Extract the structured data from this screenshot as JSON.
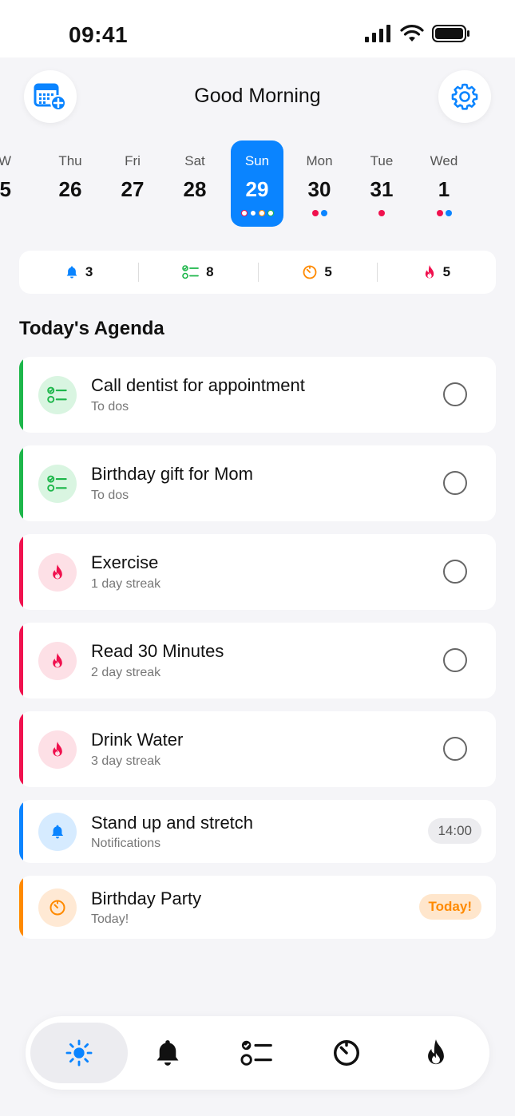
{
  "status_bar": {
    "time": "09:41"
  },
  "header": {
    "title": "Good Morning"
  },
  "week": [
    {
      "name": "Thu",
      "num": "26",
      "dots": []
    },
    {
      "name": "Fri",
      "num": "27",
      "dots": []
    },
    {
      "name": "Sat",
      "num": "28",
      "dots": []
    },
    {
      "name": "Sun",
      "num": "29",
      "dots": [
        "#f0114e",
        "#0a84ff",
        "#ff8a00",
        "#1db64a"
      ],
      "selected": true
    },
    {
      "name": "Mon",
      "num": "30",
      "dots": [
        "#f0114e",
        "#0a84ff"
      ]
    },
    {
      "name": "Tue",
      "num": "31",
      "dots": [
        "#f0114e"
      ]
    },
    {
      "name": "Wed",
      "num": "1",
      "dots": [
        "#f0114e",
        "#0a84ff"
      ]
    }
  ],
  "stats": [
    {
      "icon": "bell-icon",
      "count": "3"
    },
    {
      "icon": "checklist-icon",
      "count": "8"
    },
    {
      "icon": "timer-icon",
      "count": "5"
    },
    {
      "icon": "flame-icon",
      "count": "5"
    }
  ],
  "agenda": {
    "title": "Today's Agenda",
    "items": [
      {
        "title": "Call dentist for appointment",
        "subtitle": "To dos",
        "kind": "todo",
        "color": "#1db64a"
      },
      {
        "title": "Birthday gift for Mom",
        "subtitle": "To dos",
        "kind": "todo",
        "color": "#1db64a"
      },
      {
        "title": "Exercise",
        "subtitle": "1 day streak",
        "kind": "habit",
        "color": "#f0114e"
      },
      {
        "title": "Read 30 Minutes",
        "subtitle": "2 day streak",
        "kind": "habit",
        "color": "#f0114e"
      },
      {
        "title": "Drink Water",
        "subtitle": "3 day streak",
        "kind": "habit",
        "color": "#f0114e"
      },
      {
        "title": "Stand up and stretch",
        "subtitle": "Notifications",
        "kind": "notification",
        "color": "#0a84ff",
        "badge": "14:00"
      },
      {
        "title": "Birthday Party",
        "subtitle": "Today!",
        "kind": "countdown",
        "color": "#ff8a00",
        "badge": "Today!"
      }
    ]
  },
  "tabs": [
    "sun-icon",
    "bell-icon",
    "checklist-icon",
    "timer-icon",
    "flame-icon"
  ],
  "colors": {
    "accent": "#0a84ff",
    "green": "#1db64a",
    "red": "#f0114e",
    "orange": "#ff8a00"
  }
}
